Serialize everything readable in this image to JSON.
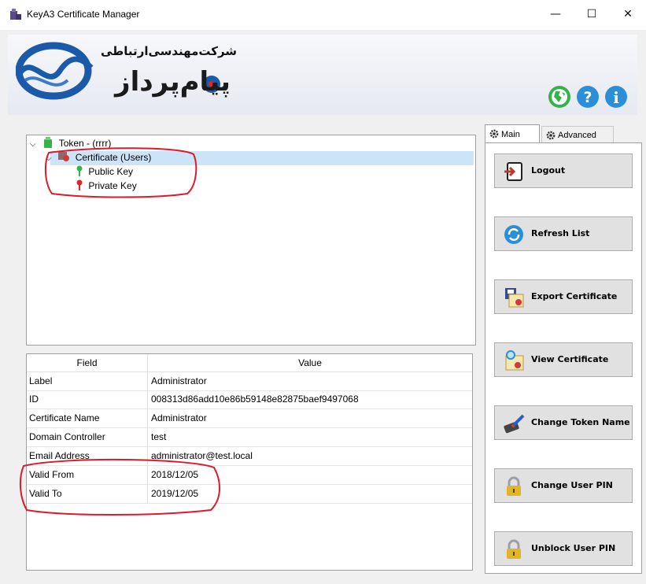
{
  "window": {
    "title": "KeyA3 Certificate Manager",
    "minimize": "—",
    "maximize": "☐",
    "close": "✕"
  },
  "banner": {
    "brand_line1": "شرکت‌مهندسی‌ارتباطی",
    "brand_line2": "پیام‌پرداز"
  },
  "tree": {
    "token_label": "Token - (rrrr)",
    "certificate_label": "Certificate (Users)",
    "public_key_label": "Public Key",
    "private_key_label": "Private Key"
  },
  "table": {
    "headers": {
      "field": "Field",
      "value": "Value"
    },
    "rows": [
      {
        "field": "Label",
        "value": "Administrator"
      },
      {
        "field": "ID",
        "value": "008313d86add10e86b59148e82875baef9497068"
      },
      {
        "field": "Certificate Name",
        "value": "Administrator"
      },
      {
        "field": "Domain Controller",
        "value": "test"
      },
      {
        "field": "Email Address",
        "value": "administrator@test.local"
      },
      {
        "field": "Valid From",
        "value": "2018/12/05"
      },
      {
        "field": "Valid To",
        "value": "2019/12/05"
      }
    ]
  },
  "tabs": {
    "main": "Main",
    "advanced": "Advanced"
  },
  "actions": {
    "logout": "Logout",
    "refresh": "Refresh List",
    "export": "Export Certificate",
    "view": "View Certificate",
    "change_name": "Change Token Name",
    "change_pin": "Change User PIN",
    "unblock_pin": "Unblock User PIN"
  },
  "colors": {
    "selection": "#cce4f7",
    "annotation": "#e0182b",
    "icon_green": "#36b24a",
    "icon_blue": "#2a8fd6",
    "brand_blue": "#1a5aa8"
  }
}
